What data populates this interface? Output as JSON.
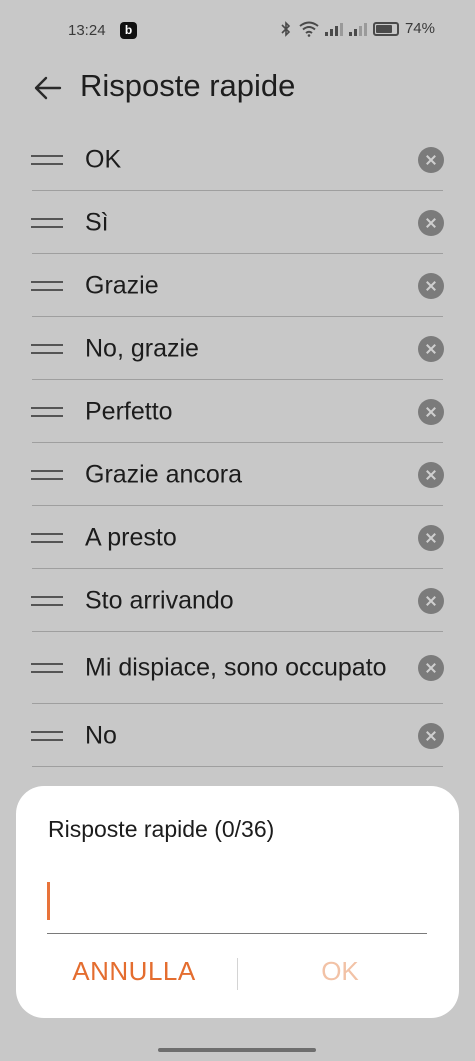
{
  "status_bar": {
    "time": "13:24",
    "app_icon_letter": "b",
    "battery": "74%",
    "icons": [
      "bluetooth-icon",
      "wifi-icon",
      "signal-icon",
      "signal-icon",
      "battery-icon"
    ]
  },
  "header": {
    "title": "Risposte rapide",
    "back_icon": "arrow-left-icon"
  },
  "list": {
    "items": [
      {
        "label": "OK"
      },
      {
        "label": "Sì"
      },
      {
        "label": "Grazie"
      },
      {
        "label": "No, grazie"
      },
      {
        "label": "Perfetto"
      },
      {
        "label": "Grazie ancora"
      },
      {
        "label": "A presto"
      },
      {
        "label": "Sto arrivando"
      },
      {
        "label": "Mi dispiace, sono occupato"
      },
      {
        "label": "No"
      }
    ]
  },
  "dialog": {
    "title": "Risposte rapide (0/36)",
    "input_value": "",
    "cancel_label": "ANNULLA",
    "ok_label": "OK"
  },
  "colors": {
    "accent": "#e46d2f",
    "accent_disabled": "#f2c2a6",
    "scrim_background": "#c8c8c8"
  }
}
